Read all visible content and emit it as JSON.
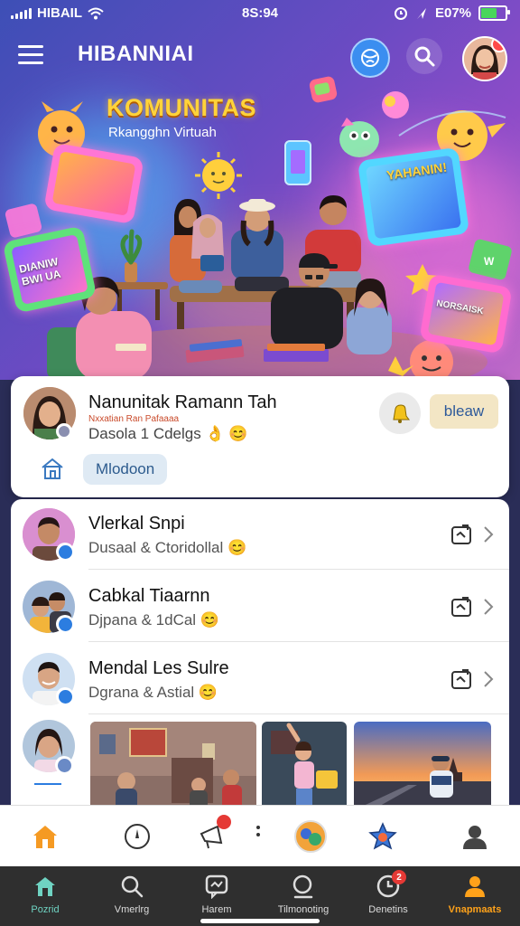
{
  "status_bar": {
    "carrier": "HIBAIL",
    "time": "8S:94",
    "battery": "E07%"
  },
  "app": {
    "title": "HIBANNIAI"
  },
  "hero": {
    "title": "KOMUNITAS",
    "subtitle": "Rkangghn Virtuah",
    "tablet_left_label": "DIANIW BWI UA",
    "tablet_right_label": "YAHANIN!",
    "tablet_bottom_right_label": "NORSAISK"
  },
  "featured": {
    "name": "Nanunitak Ramann Tah",
    "tag": "Nxxatian Ran Pafaaaa",
    "status": "Dasola 1 Cdelgs 👌 😊",
    "join_label": "bleaw",
    "chip_label": "Mlodoon"
  },
  "list": [
    {
      "name": "Vlerkal Snpi",
      "sub": "Dusaal & Ctoridollal 😊"
    },
    {
      "name": "Cabkal Tiaarnn",
      "sub": "Djpana & 1dCal 😊"
    },
    {
      "name": "Mendal Les Sulre",
      "sub": "Dgrana & Astial 😊"
    }
  ],
  "tabs": [
    {
      "label": "Pozrid"
    },
    {
      "label": "Vmerlrg"
    },
    {
      "label": "Harem"
    },
    {
      "label": "Tilmonoting"
    },
    {
      "label": "Denetins"
    },
    {
      "label": "Vnapmaats"
    }
  ],
  "badges": {
    "notification_count": "2"
  },
  "colors": {
    "accent": "#ffa21a",
    "verified": "#2c7de0",
    "brand_title": "#ffd33a"
  }
}
